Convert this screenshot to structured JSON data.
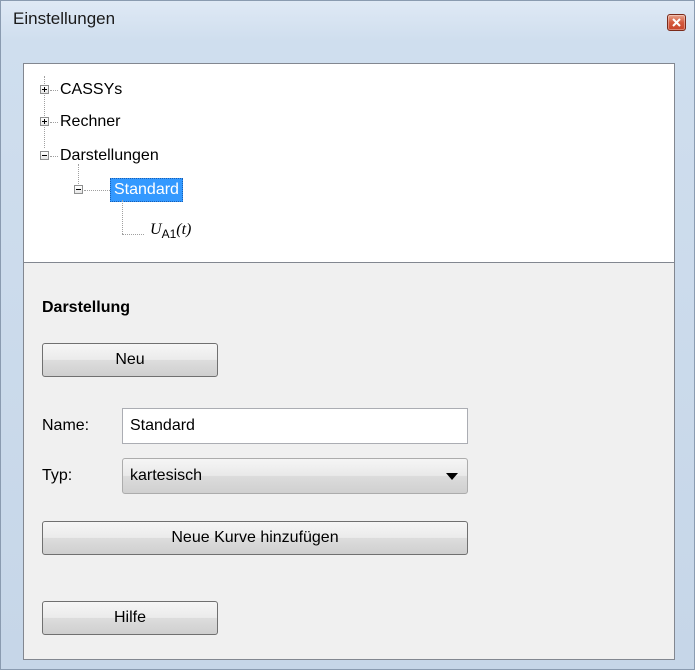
{
  "window": {
    "title": "Einstellungen"
  },
  "tree": {
    "nodes": [
      {
        "label": "CASSYs",
        "expanded": false
      },
      {
        "label": "Rechner",
        "expanded": false
      },
      {
        "label": "Darstellungen",
        "expanded": true
      },
      {
        "label": "Standard",
        "expanded": true,
        "selected": true
      },
      {
        "label_symbol": "U",
        "label_subscript": "A1",
        "label_suffix": "(t)"
      }
    ]
  },
  "panel": {
    "section_title": "Darstellung",
    "new_button": "Neu",
    "name_label": "Name:",
    "name_value": "Standard",
    "type_label": "Typ:",
    "type_value": "kartesisch",
    "add_curve_button": "Neue Kurve hinzufügen",
    "help_button": "Hilfe"
  },
  "colors": {
    "selection": "#3399ff",
    "close_button": "#c8442a",
    "window_frame": "#cfdeee"
  }
}
